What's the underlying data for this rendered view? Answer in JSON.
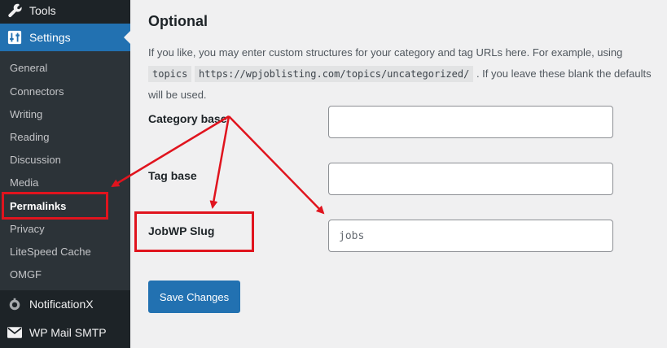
{
  "sidebar": {
    "tools_label": "Tools",
    "settings_label": "Settings",
    "submenu": [
      "General",
      "Connectors",
      "Writing",
      "Reading",
      "Discussion",
      "Media",
      "Permalinks",
      "Privacy",
      "LiteSpeed Cache",
      "OMGF"
    ],
    "current": "Permalinks",
    "notificationx_label": "NotificationX",
    "wpmail_label": "WP Mail SMTP"
  },
  "main": {
    "section_title": "Optional",
    "desc_before": "If you like, you may enter custom structures for your category and tag URLs here. For example, using ",
    "desc_code1": "topics",
    "desc_code2": "https://wpjoblisting.com/topics/uncategorized/",
    "desc_after": " . If you leave these blank the defaults will be used.",
    "category_base_label": "Category base",
    "category_base_value": "",
    "tag_base_label": "Tag base",
    "tag_base_value": "",
    "jobwp_slug_label": "JobWP Slug",
    "jobwp_slug_placeholder": "jobs",
    "save_label": "Save Changes"
  },
  "colors": {
    "sidebar_bg": "#1d2327",
    "submenu_bg": "#2c3338",
    "accent": "#2271b1",
    "annotation": "#e0141e"
  },
  "icons": {
    "tools": "wrench-icon",
    "settings": "sliders-icon",
    "notificationx": "notification-icon",
    "wpmail": "envelope-icon"
  }
}
